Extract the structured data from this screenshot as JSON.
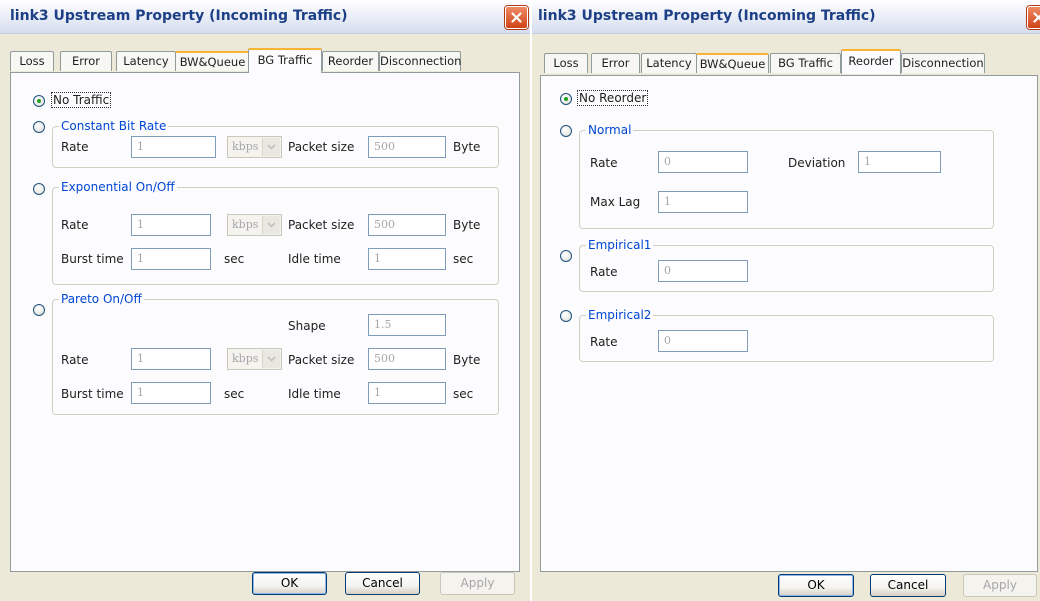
{
  "left": {
    "title": "link3 Upstream Property (Incoming Traffic)",
    "tabs": [
      "Loss",
      "Error",
      "Latency",
      "BW&Queue",
      "BG Traffic",
      "Reorder",
      "Disconnection"
    ],
    "no_traffic": "No Traffic",
    "cbr": {
      "title": "Constant Bit Rate",
      "rate_label": "Rate",
      "rate": "1",
      "unit": "kbps",
      "pkt_label": "Packet size",
      "pkt": "500",
      "byte": "Byte"
    },
    "exp": {
      "title": "Exponential On/Off",
      "rate_label": "Rate",
      "rate": "1",
      "unit": "kbps",
      "pkt_label": "Packet size",
      "pkt": "500",
      "byte": "Byte",
      "burst_label": "Burst time",
      "burst": "1",
      "sec1": "sec",
      "idle_label": "Idle time",
      "idle": "1",
      "sec2": "sec"
    },
    "pareto": {
      "title": "Pareto On/Off",
      "shape_label": "Shape",
      "shape": "1.5",
      "rate_label": "Rate",
      "rate": "1",
      "unit": "kbps",
      "pkt_label": "Packet size",
      "pkt": "500",
      "byte": "Byte",
      "burst_label": "Burst time",
      "burst": "1",
      "sec1": "sec",
      "idle_label": "Idle time",
      "idle": "1",
      "sec2": "sec"
    },
    "buttons": {
      "ok": "OK",
      "cancel": "Cancel",
      "apply": "Apply"
    }
  },
  "right": {
    "title": "link3 Upstream Property (Incoming Traffic)",
    "tabs": [
      "Loss",
      "Error",
      "Latency",
      "BW&Queue",
      "BG Traffic",
      "Reorder",
      "Disconnection"
    ],
    "no_reorder": "No Reorder",
    "normal": {
      "title": "Normal",
      "rate_label": "Rate",
      "rate": "0",
      "dev_label": "Deviation",
      "dev": "1",
      "lag_label": "Max Lag",
      "lag": "1"
    },
    "emp1": {
      "title": "Empirical1",
      "rate_label": "Rate",
      "rate": "0"
    },
    "emp2": {
      "title": "Empirical2",
      "rate_label": "Rate",
      "rate": "0"
    },
    "buttons": {
      "ok": "OK",
      "cancel": "Cancel",
      "apply": "Apply"
    }
  },
  "colors": {
    "accent": "#0046d5",
    "title": "#1c3f86",
    "close": "#d04317",
    "tab_hot": "#f8b334"
  },
  "icons": {
    "close": "close-icon",
    "dropdown": "chevron-down-icon"
  }
}
